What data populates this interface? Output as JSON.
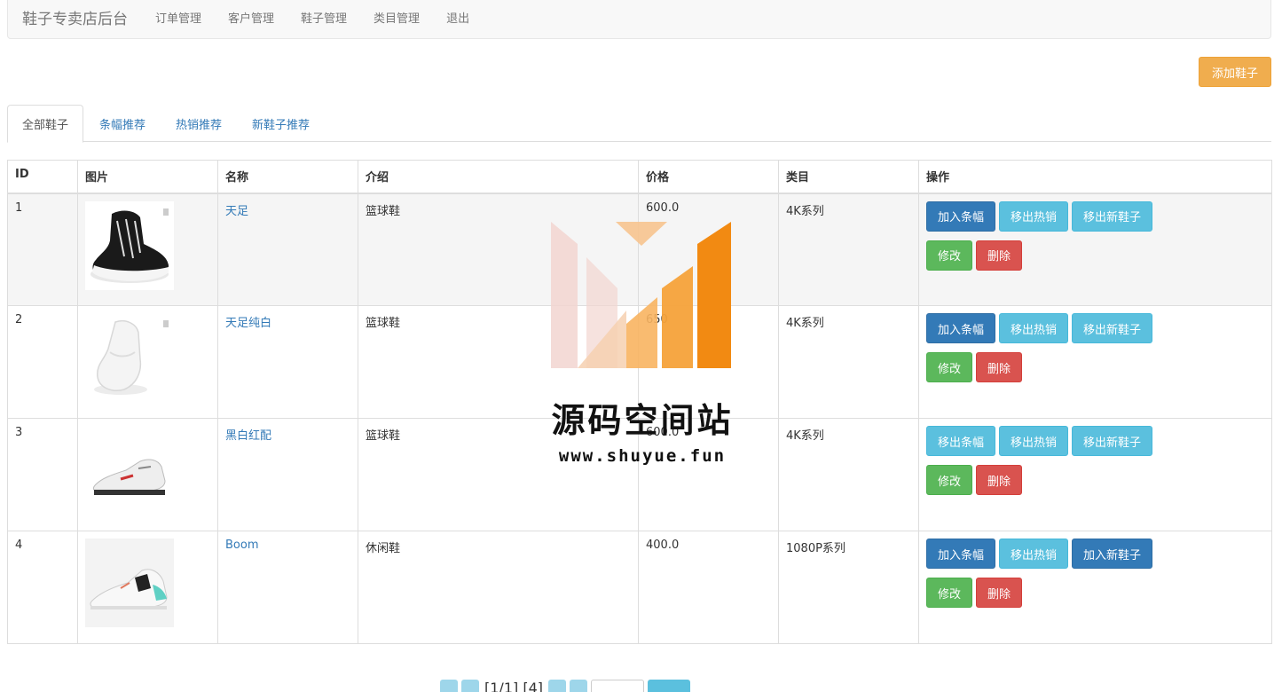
{
  "navbar": {
    "brand": "鞋子专卖店后台",
    "links": [
      "订单管理",
      "客户管理",
      "鞋子管理",
      "类目管理",
      "退出"
    ]
  },
  "toolbar": {
    "add_label": "添加鞋子"
  },
  "tabs": [
    "全部鞋子",
    "条幅推荐",
    "热销推荐",
    "新鞋子推荐"
  ],
  "table": {
    "headers": [
      "ID",
      "图片",
      "名称",
      "介绍",
      "价格",
      "类目",
      "操作"
    ],
    "rows": [
      {
        "id": "1",
        "name": "天足",
        "intro": "篮球鞋",
        "price": "600.0",
        "category": "4K系列",
        "btn1": "加入条幅",
        "btn2": "移出热销",
        "btn3": "移出新鞋子",
        "edit": "修改",
        "delete": "删除"
      },
      {
        "id": "2",
        "name": "天足纯白",
        "intro": "篮球鞋",
        "price": "650",
        "category": "4K系列",
        "btn1": "加入条幅",
        "btn2": "移出热销",
        "btn3": "移出新鞋子",
        "edit": "修改",
        "delete": "删除"
      },
      {
        "id": "3",
        "name": "黑白红配",
        "intro": "篮球鞋",
        "price": "600.0",
        "category": "4K系列",
        "btn1": "移出条幅",
        "btn2": "移出热销",
        "btn3": "移出新鞋子",
        "edit": "修改",
        "delete": "删除"
      },
      {
        "id": "4",
        "name": "Boom",
        "intro": "休闲鞋",
        "price": "400.0",
        "category": "1080P系列",
        "btn1": "加入条幅",
        "btn2": "移出热销",
        "btn3": "加入新鞋子",
        "edit": "修改",
        "delete": "删除"
      }
    ]
  },
  "watermark": {
    "title": "源码空间站",
    "url": "www.shuyue.fun"
  },
  "pager": {
    "info": "[1/1] [4]"
  },
  "colors": {
    "primary": "#337ab7",
    "info": "#5bc0de",
    "success": "#5cb85c",
    "danger": "#d9534f",
    "warning": "#f0ad4e"
  }
}
